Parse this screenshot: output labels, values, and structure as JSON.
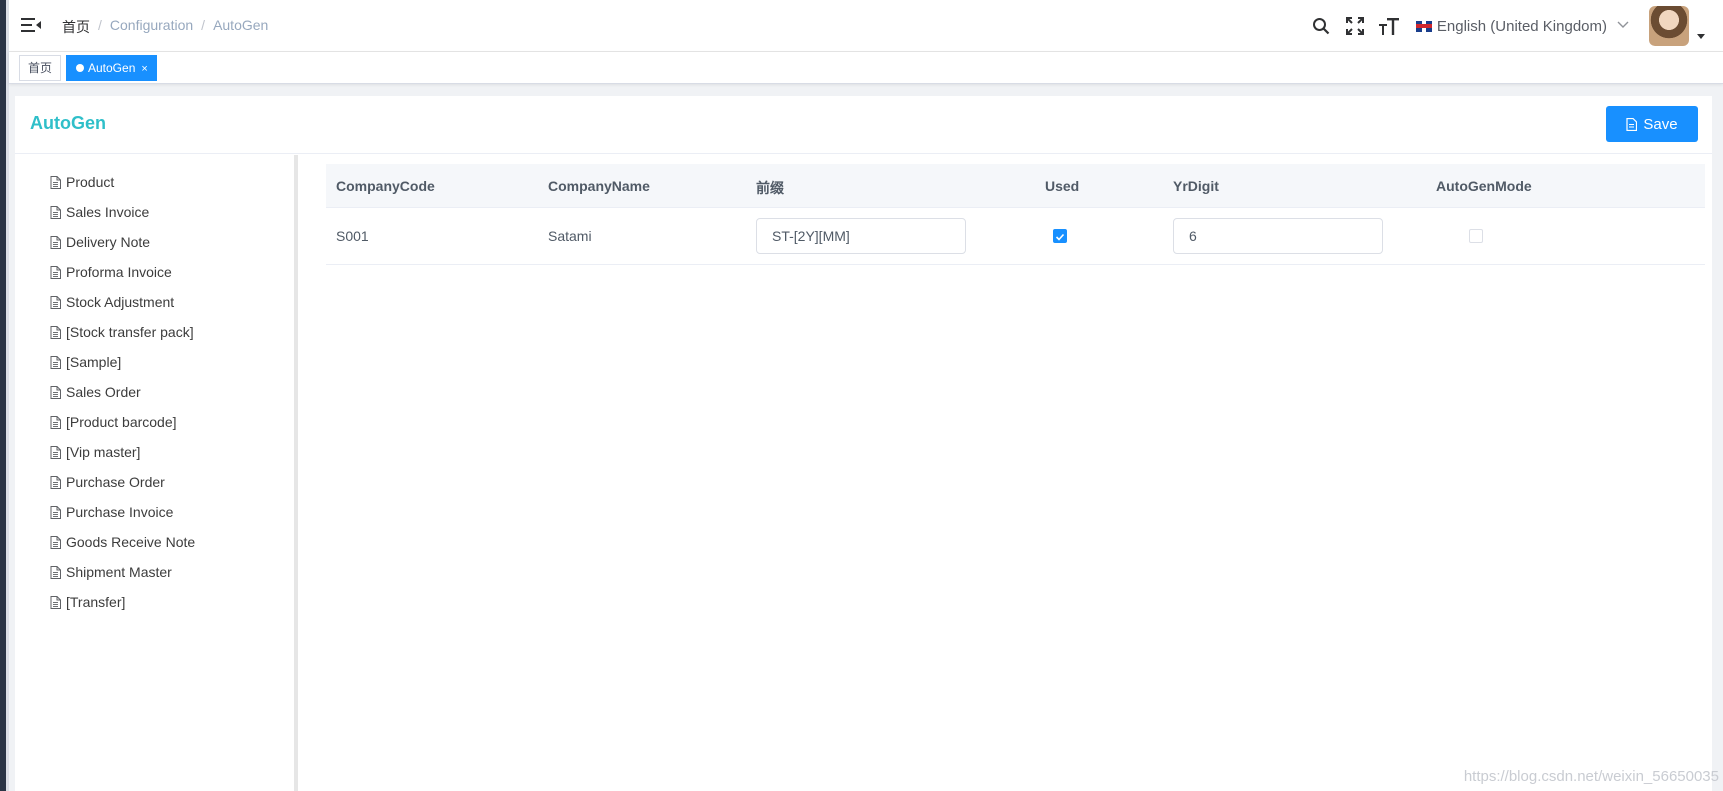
{
  "breadcrumb": {
    "home": "首页",
    "sep1": "/",
    "section": "Configuration",
    "sep2": "/",
    "current": "AutoGen"
  },
  "header": {
    "language": "English (United Kingdom)"
  },
  "tags": {
    "home": "首页",
    "active": "AutoGen",
    "close": "×"
  },
  "page": {
    "title": "AutoGen",
    "save_label": "Save"
  },
  "tree": {
    "items": [
      "Product",
      "Sales Invoice",
      "Delivery Note",
      "Proforma Invoice",
      "Stock Adjustment",
      "[Stock transfer pack]",
      "[Sample]",
      "Sales Order",
      "[Product barcode]",
      "[Vip master]",
      "Purchase Order",
      "Purchase Invoice",
      "Goods Receive Note",
      "Shipment Master",
      "[Transfer]"
    ]
  },
  "table": {
    "headers": [
      "CompanyCode",
      "CompanyName",
      "前缀",
      "Used",
      "YrDigit",
      "AutoGenMode"
    ],
    "rows": [
      {
        "company_code": "S001",
        "company_name": "Satami",
        "prefix": "ST-[2Y][MM]",
        "used": true,
        "yr_digit": "6",
        "autogen_mode": false
      }
    ]
  },
  "colors": {
    "accent": "#1890ff",
    "title": "#2fbfc9"
  },
  "watermark": "https://blog.csdn.net/weixin_56650035"
}
